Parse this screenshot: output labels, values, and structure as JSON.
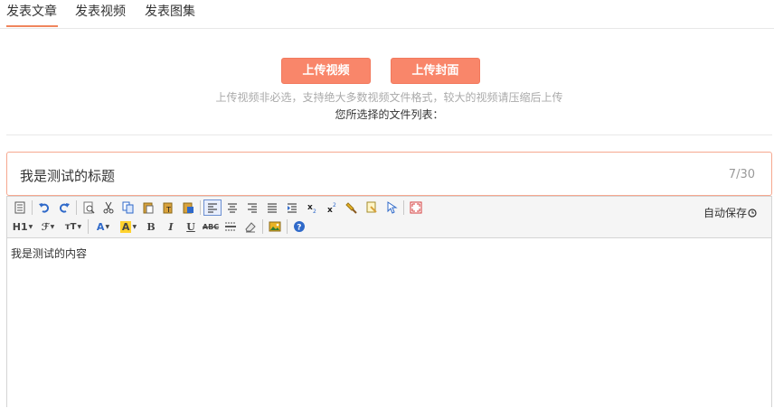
{
  "tabs": [
    {
      "label": "发表文章",
      "active": true
    },
    {
      "label": "发表视频",
      "active": false
    },
    {
      "label": "发表图集",
      "active": false
    }
  ],
  "upload": {
    "video_button": "上传视频",
    "cover_button": "上传封面",
    "hint": "上传视频非必选，支持绝大多数视频文件格式，较大的视频请压缩后上传",
    "file_list_label": "您所选择的文件列表："
  },
  "title": {
    "value": "我是测试的标题",
    "counter": "7/30"
  },
  "editor": {
    "autosave_label": "自动保存",
    "content": "我是测试的内容",
    "toolbar": {
      "heading_label": "H1",
      "font_family_label": "ℱ",
      "font_size_label": "тT",
      "font_color_label": "A",
      "bg_color_label": "A",
      "bold_label": "B",
      "italic_label": "I",
      "underline_label": "U",
      "strike_label": "ABC"
    }
  },
  "colors": {
    "accent": "#f9866a",
    "tab_underline": "#f0855d",
    "title_border": "#f6a88f"
  }
}
